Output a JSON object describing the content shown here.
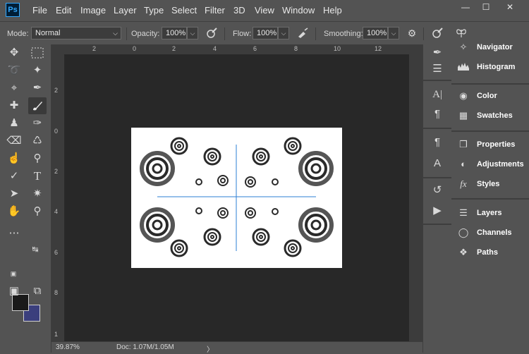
{
  "app": {
    "logo": "Ps"
  },
  "menu": [
    "File",
    "Edit",
    "Image",
    "Layer",
    "Type",
    "Select",
    "Filter",
    "3D",
    "View",
    "Window",
    "Help"
  ],
  "window_controls": {
    "minimize": "—",
    "restore": "☐",
    "close": "✕"
  },
  "options": {
    "mode_label": "Mode:",
    "mode_value": "Normal",
    "opacity_label": "Opacity:",
    "opacity_value": "100%",
    "flow_label": "Flow:",
    "flow_value": "100%",
    "smoothing_label": "Smoothing:",
    "smoothing_value": "100%"
  },
  "rulers": {
    "horizontal": [
      "2",
      "0",
      "2",
      "4",
      "6",
      "8",
      "10",
      "12"
    ],
    "vertical": [
      "2",
      "0",
      "2",
      "4",
      "6",
      "8",
      "1"
    ]
  },
  "status": {
    "zoom": "39.87%",
    "doc": "Doc: 1.07M/1.05M",
    "arrow": "〉"
  },
  "panels": [
    "Navigator",
    "Histogram",
    "Color",
    "Swatches",
    "Properties",
    "Adjustments",
    "Styles",
    "Layers",
    "Channels",
    "Paths"
  ],
  "colors": {
    "foreground": "#1a1a1a",
    "background": "#3b3f7d",
    "guide": "#2e7fd6"
  }
}
